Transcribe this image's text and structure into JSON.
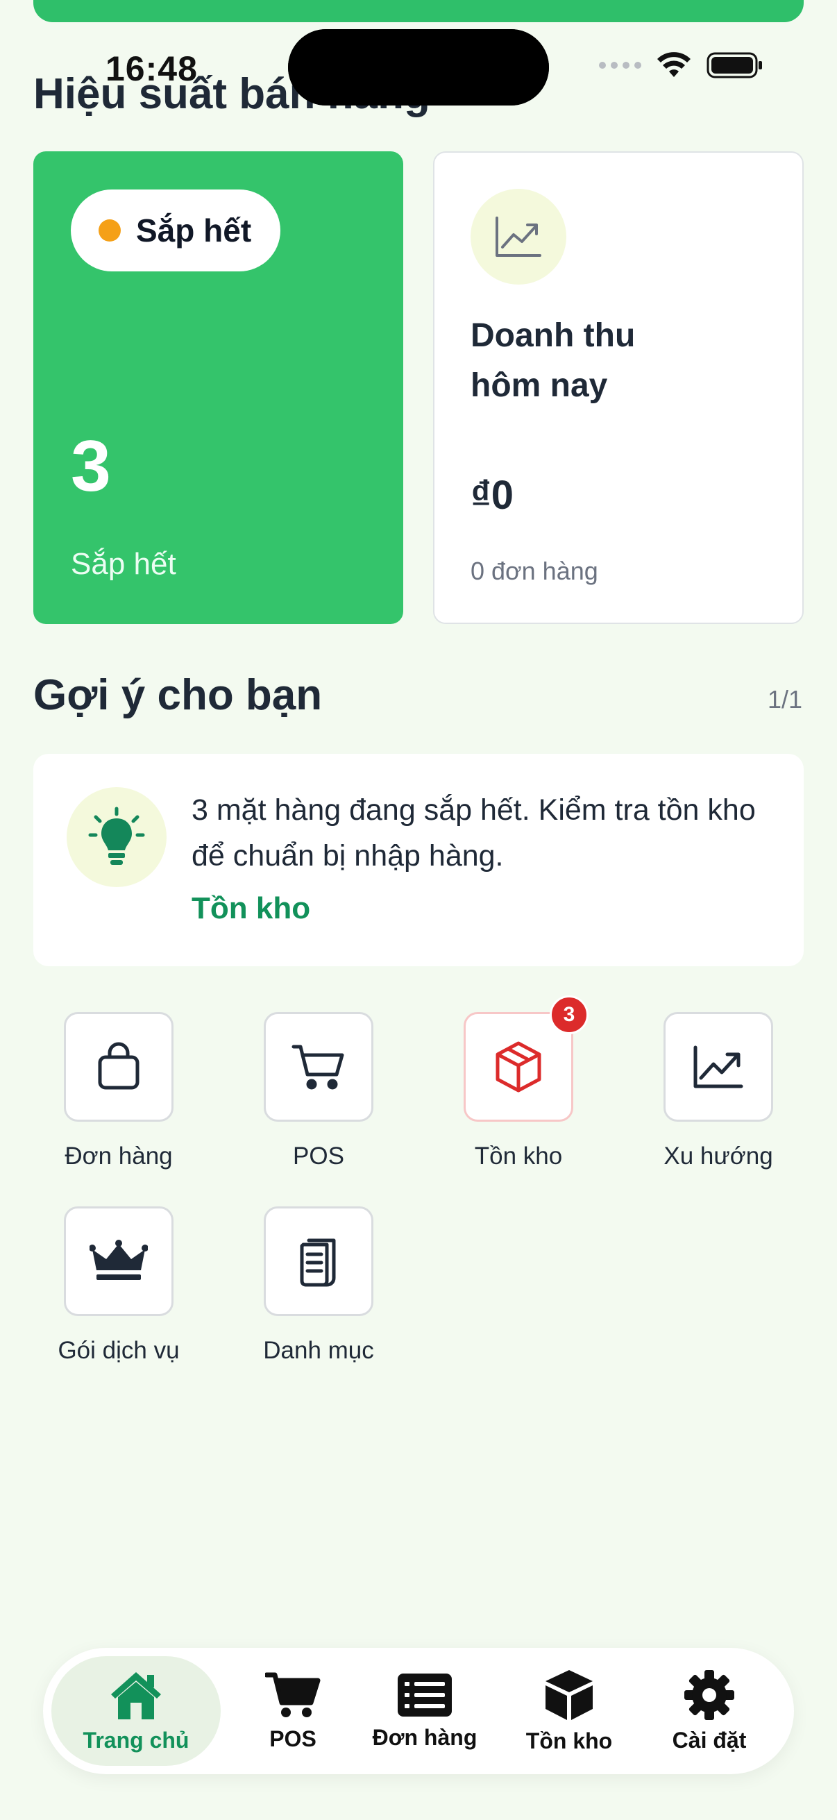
{
  "status_bar": {
    "time": "16:48"
  },
  "performance": {
    "title": "Hiệu suất bán hàng",
    "low_stock_card": {
      "pill_label": "Sắp hết",
      "count": "3",
      "label": "Sắp hết"
    },
    "revenue_card": {
      "title_line1": "Doanh thu",
      "title_line2": "hôm nay",
      "value": "₫0",
      "orders": "0 đơn hàng"
    }
  },
  "suggestions": {
    "title": "Gợi ý cho bạn",
    "page": "1/1",
    "message": "3 mặt hàng đang sắp hết. Kiểm tra tồn kho để chuẩn bị nhập hàng.",
    "action": "Tồn kho"
  },
  "quick_actions": [
    {
      "label": "Đơn hàng",
      "icon": "bag-icon"
    },
    {
      "label": "POS",
      "icon": "cart-icon"
    },
    {
      "label": "Tồn kho",
      "icon": "box-icon",
      "badge": "3"
    },
    {
      "label": "Xu hướng",
      "icon": "trend-icon"
    },
    {
      "label": "Gói dịch vụ",
      "icon": "crown-icon"
    },
    {
      "label": "Danh mục",
      "icon": "catalog-icon"
    }
  ],
  "tabbar": [
    {
      "label": "Trang chủ",
      "icon": "home-icon",
      "active": true
    },
    {
      "label": "POS",
      "icon": "cart-icon"
    },
    {
      "label": "Đơn hàng",
      "icon": "list-icon"
    },
    {
      "label": "Tồn kho",
      "icon": "box-icon"
    },
    {
      "label": "Cài đặt",
      "icon": "gear-icon"
    }
  ],
  "colors": {
    "brand_green": "#34c46b",
    "accent_text": "#12915a",
    "warning": "#f5a017",
    "badge": "#dc2b2b"
  }
}
